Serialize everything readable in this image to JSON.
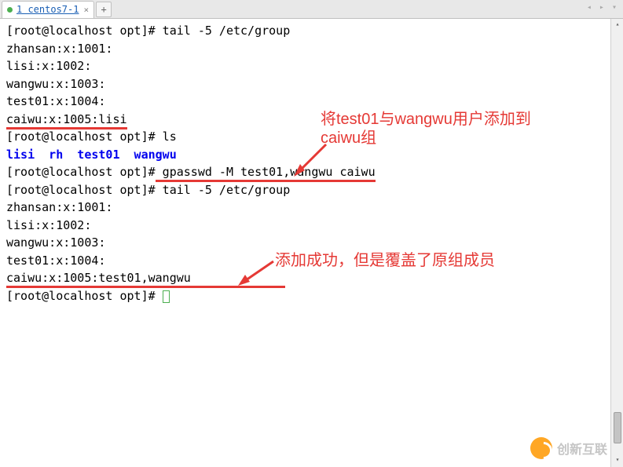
{
  "tab": {
    "label": "1 centos7-1",
    "close_icon": "×",
    "new_tab_icon": "+"
  },
  "nav": {
    "arrows": "◂ ▸ ▾"
  },
  "terminal": {
    "lines": [
      {
        "type": "plain",
        "text": "[root@localhost opt]# tail -5 /etc/group"
      },
      {
        "type": "plain",
        "text": "zhansan:x:1001:"
      },
      {
        "type": "plain",
        "text": "lisi:x:1002:"
      },
      {
        "type": "plain",
        "text": "wangwu:x:1003:"
      },
      {
        "type": "plain",
        "text": "test01:x:1004:"
      },
      {
        "type": "underlined",
        "text": "caiwu:x:1005:lisi"
      },
      {
        "type": "plain",
        "text": "[root@localhost opt]# ls"
      },
      {
        "type": "blue",
        "text": "lisi  rh  test01  wangwu"
      },
      {
        "type": "split",
        "prefix": "[root@localhost opt]#",
        "underlined": " gpasswd -M test01,wangwu caiwu"
      },
      {
        "type": "plain",
        "text": "[root@localhost opt]# tail -5 /etc/group"
      },
      {
        "type": "plain",
        "text": "zhansan:x:1001:"
      },
      {
        "type": "plain",
        "text": "lisi:x:1002:"
      },
      {
        "type": "plain",
        "text": "wangwu:x:1003:"
      },
      {
        "type": "plain",
        "text": "test01:x:1004:"
      },
      {
        "type": "underlined-wide",
        "text": "caiwu:x:1005:test01,wangwu"
      },
      {
        "type": "cursor",
        "text": "[root@localhost opt]# "
      }
    ]
  },
  "annotations": {
    "a1_line1": "将test01与wangwu用户添加到",
    "a1_line2": "caiwu组",
    "a2": "添加成功，但是覆盖了原组成员"
  },
  "watermark": {
    "text": "创新互联"
  }
}
